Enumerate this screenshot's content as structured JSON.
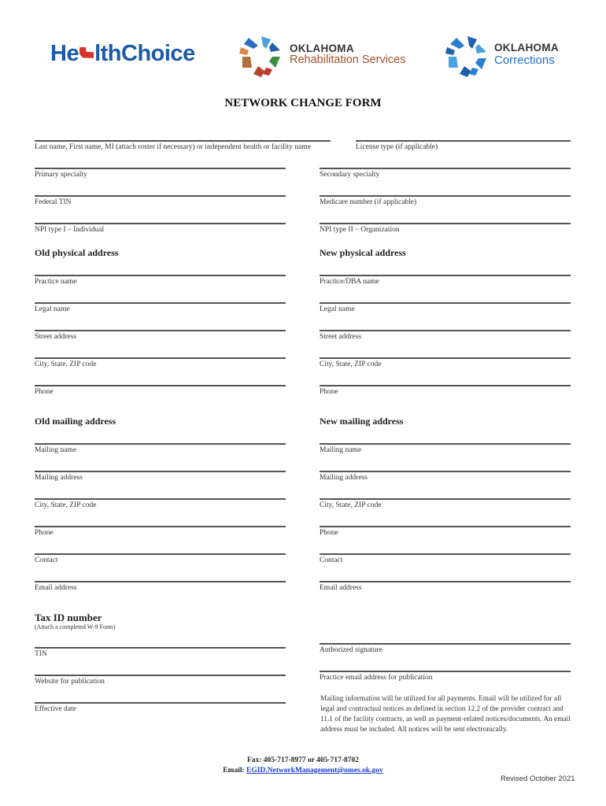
{
  "logos": {
    "healthchoice": {
      "text_before": "He",
      "text_after": "lthChoice",
      "color": "#1a5aa8",
      "accent": "#d7312b"
    },
    "rehab": {
      "top": "OKLAHOMA",
      "bottom": "Rehabilitation Services",
      "color": "#a0522d"
    },
    "corrections": {
      "top": "OKLAHOMA",
      "bottom": "Corrections",
      "color": "#1f6fc0"
    }
  },
  "title": "NETWORK CHANGE FORM",
  "top_fields": {
    "name": "Last name, First name, MI (attach roster if necessary) or independent health or facility name",
    "license": "License type (if applicable)",
    "primary_specialty": "Primary specialty",
    "secondary_specialty": "Secondary specialty",
    "federal_tin": "Federal TIN",
    "medicare": "Medicare number (if applicable)",
    "npi1": "NPI type I – Individual",
    "npi2": "NPI type II – Organization"
  },
  "physical": {
    "old_title": "Old physical address",
    "new_title": "New physical address",
    "old_fields": [
      "Practice name",
      "Legal name",
      "Street address",
      "City, State, ZIP code",
      "Phone"
    ],
    "new_fields": [
      "Practice/DBA name",
      "Legal name",
      "Street address",
      "City, State, ZIP code",
      "Phone"
    ]
  },
  "mailing": {
    "old_title": "Old mailing address",
    "new_title": "New mailing address",
    "old_fields": [
      "Mailing name",
      "Mailing address",
      "City, State, ZIP code",
      "Phone",
      "Contact",
      "Email address"
    ],
    "new_fields": [
      "Mailing name",
      "Mailing address",
      "City, State, ZIP code",
      "Phone",
      "Contact",
      "Email address"
    ]
  },
  "tax": {
    "title": "Tax ID number",
    "note": "(Attach a completed W-9 Form)",
    "fields": [
      "TIN",
      "Website for publication",
      "Effective date"
    ],
    "right_fields": [
      "Authorized signature",
      "Practice email address for publication"
    ]
  },
  "notice": "Mailing information will be utilized for all payments. Email will be utilized for all legal and contractual notices as defined in section 12.2 of the provider contract and 11.1 of the facility contracts, as well as payment-related notices/documents. An email address must be included. All notices will be sent electronically.",
  "footer": {
    "fax": "Fax: 405-717-8977 or 405-717-8702",
    "email_label": "Email: ",
    "email": "EGID.NetworkManagement@omes.ok.gov",
    "revised": "Revised October 2021"
  }
}
